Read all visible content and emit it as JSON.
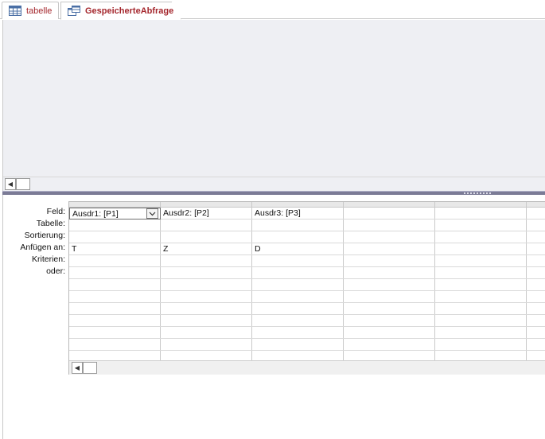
{
  "tabs": [
    {
      "label": "tabelle",
      "icon": "table-icon"
    },
    {
      "label": "GespeicherteAbfrage",
      "icon": "query-icon"
    }
  ],
  "row_labels": [
    "Feld:",
    "Tabelle:",
    "Sortierung:",
    "Anfügen an:",
    "Kriterien:",
    "oder:"
  ],
  "grid": {
    "columns": [
      {
        "feld": "Ausdr1: [P1]",
        "anfuegen": "T"
      },
      {
        "feld": "Ausdr2: [P2]",
        "anfuegen": "Z"
      },
      {
        "feld": "Ausdr3: [P3]",
        "anfuegen": "D"
      },
      {
        "feld": "",
        "anfuegen": ""
      },
      {
        "feld": "",
        "anfuegen": ""
      }
    ]
  },
  "colors": {
    "tab_text": "#a4262c",
    "pane_bg": "#eeeff3",
    "splitter": "#7b7b96"
  }
}
